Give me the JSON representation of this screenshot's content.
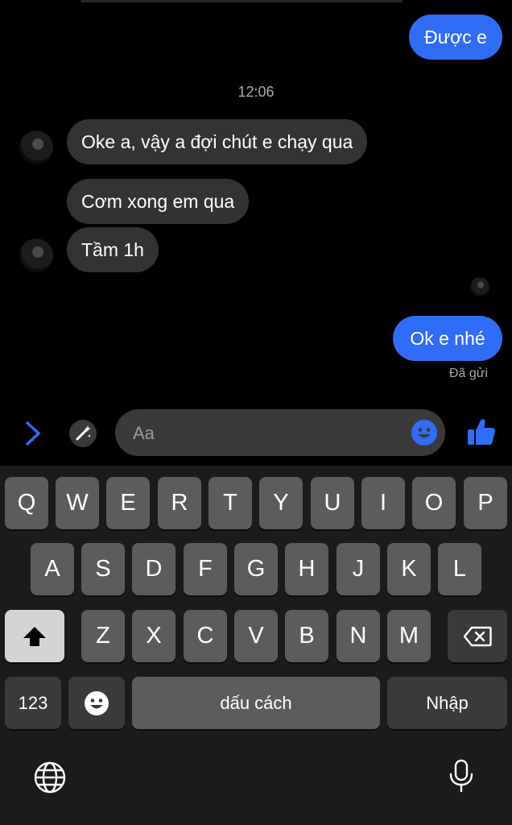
{
  "conversation": {
    "messages": [
      {
        "direction": "out",
        "text": "Được e"
      },
      {
        "direction": "in",
        "text": "Oke a, vậy a đợi chút e chạy qua"
      },
      {
        "direction": "in",
        "text": "Cơm xong em qua"
      },
      {
        "direction": "in",
        "text": "Tầm 1h"
      },
      {
        "direction": "out",
        "text": "Ok e nhé"
      }
    ],
    "timestamp": "12:06",
    "delivery_status": "Đã gửi"
  },
  "composer": {
    "placeholder": "Aa",
    "icons": [
      "chevron-right-icon",
      "magic-wand-icon",
      "emoji-icon",
      "thumbs-up-icon"
    ]
  },
  "keyboard": {
    "row1": [
      "Q",
      "W",
      "E",
      "R",
      "T",
      "Y",
      "U",
      "I",
      "O",
      "P"
    ],
    "row2": [
      "A",
      "S",
      "D",
      "F",
      "G",
      "H",
      "J",
      "K",
      "L"
    ],
    "row3": [
      "Z",
      "X",
      "C",
      "V",
      "B",
      "N",
      "M"
    ],
    "numbers_label": "123",
    "space_label": "dấu cách",
    "return_label": "Nhập",
    "icons": [
      "shift-icon",
      "backspace-icon",
      "emoji-icon",
      "globe-icon",
      "microphone-icon"
    ]
  },
  "colors": {
    "accent": "#2f6df6",
    "incoming_bubble": "#333335",
    "background": "#000000",
    "key": "#5c5c5e"
  }
}
